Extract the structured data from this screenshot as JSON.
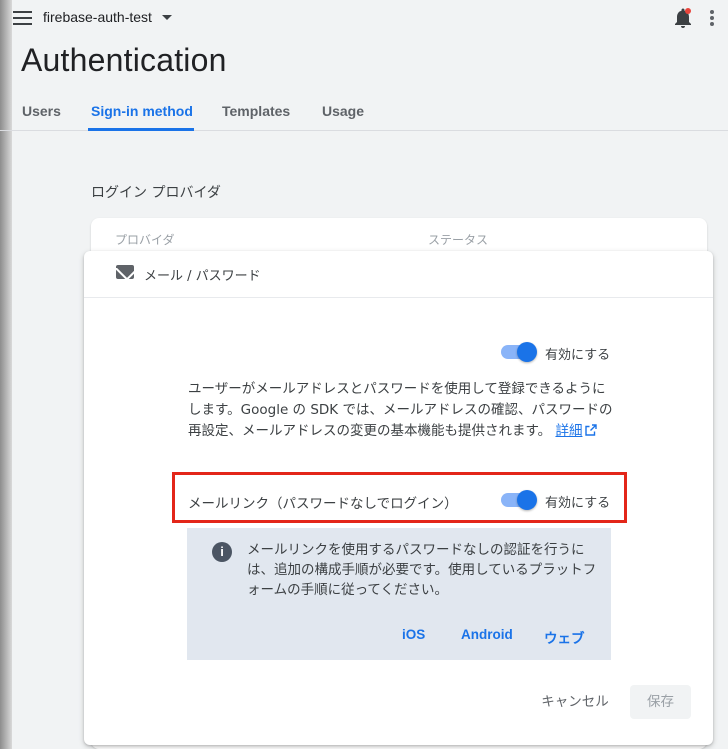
{
  "header": {
    "project_name": "firebase-auth-test",
    "page_title": "Authentication"
  },
  "tabs": [
    {
      "label": "Users",
      "active": false
    },
    {
      "label": "Sign-in method",
      "active": true
    },
    {
      "label": "Templates",
      "active": false
    },
    {
      "label": "Usage",
      "active": false
    }
  ],
  "providers": {
    "section_title": "ログイン プロバイダ",
    "col_provider": "プロバイダ",
    "col_status": "ステータス"
  },
  "modal": {
    "title": "メール / パスワード",
    "enable_toggle": {
      "label": "有効にする",
      "on": true
    },
    "description": "ユーザーがメールアドレスとパスワードを使用して登録できるようにします。Google の SDK では、メールアドレスの確認、パスワードの再設定、メールアドレスの変更の基本機能も提供されます。",
    "details_link": "詳細",
    "email_link_label": "メールリンク（パスワードなしでログイン）",
    "email_link_toggle": {
      "label": "有効にする",
      "on": true
    },
    "info_text": "メールリンクを使用するパスワードなしの認証を行うには、追加の構成手順が必要です。使用しているプラットフォームの手順に従ってください。",
    "platforms": [
      "iOS",
      "Android",
      "ウェブ"
    ],
    "cancel_label": "キャンセル",
    "save_label": "保存"
  },
  "colors": {
    "accent": "#1a73e8",
    "highlight_box": "#e32619",
    "info_bg": "#e1e7ef"
  }
}
